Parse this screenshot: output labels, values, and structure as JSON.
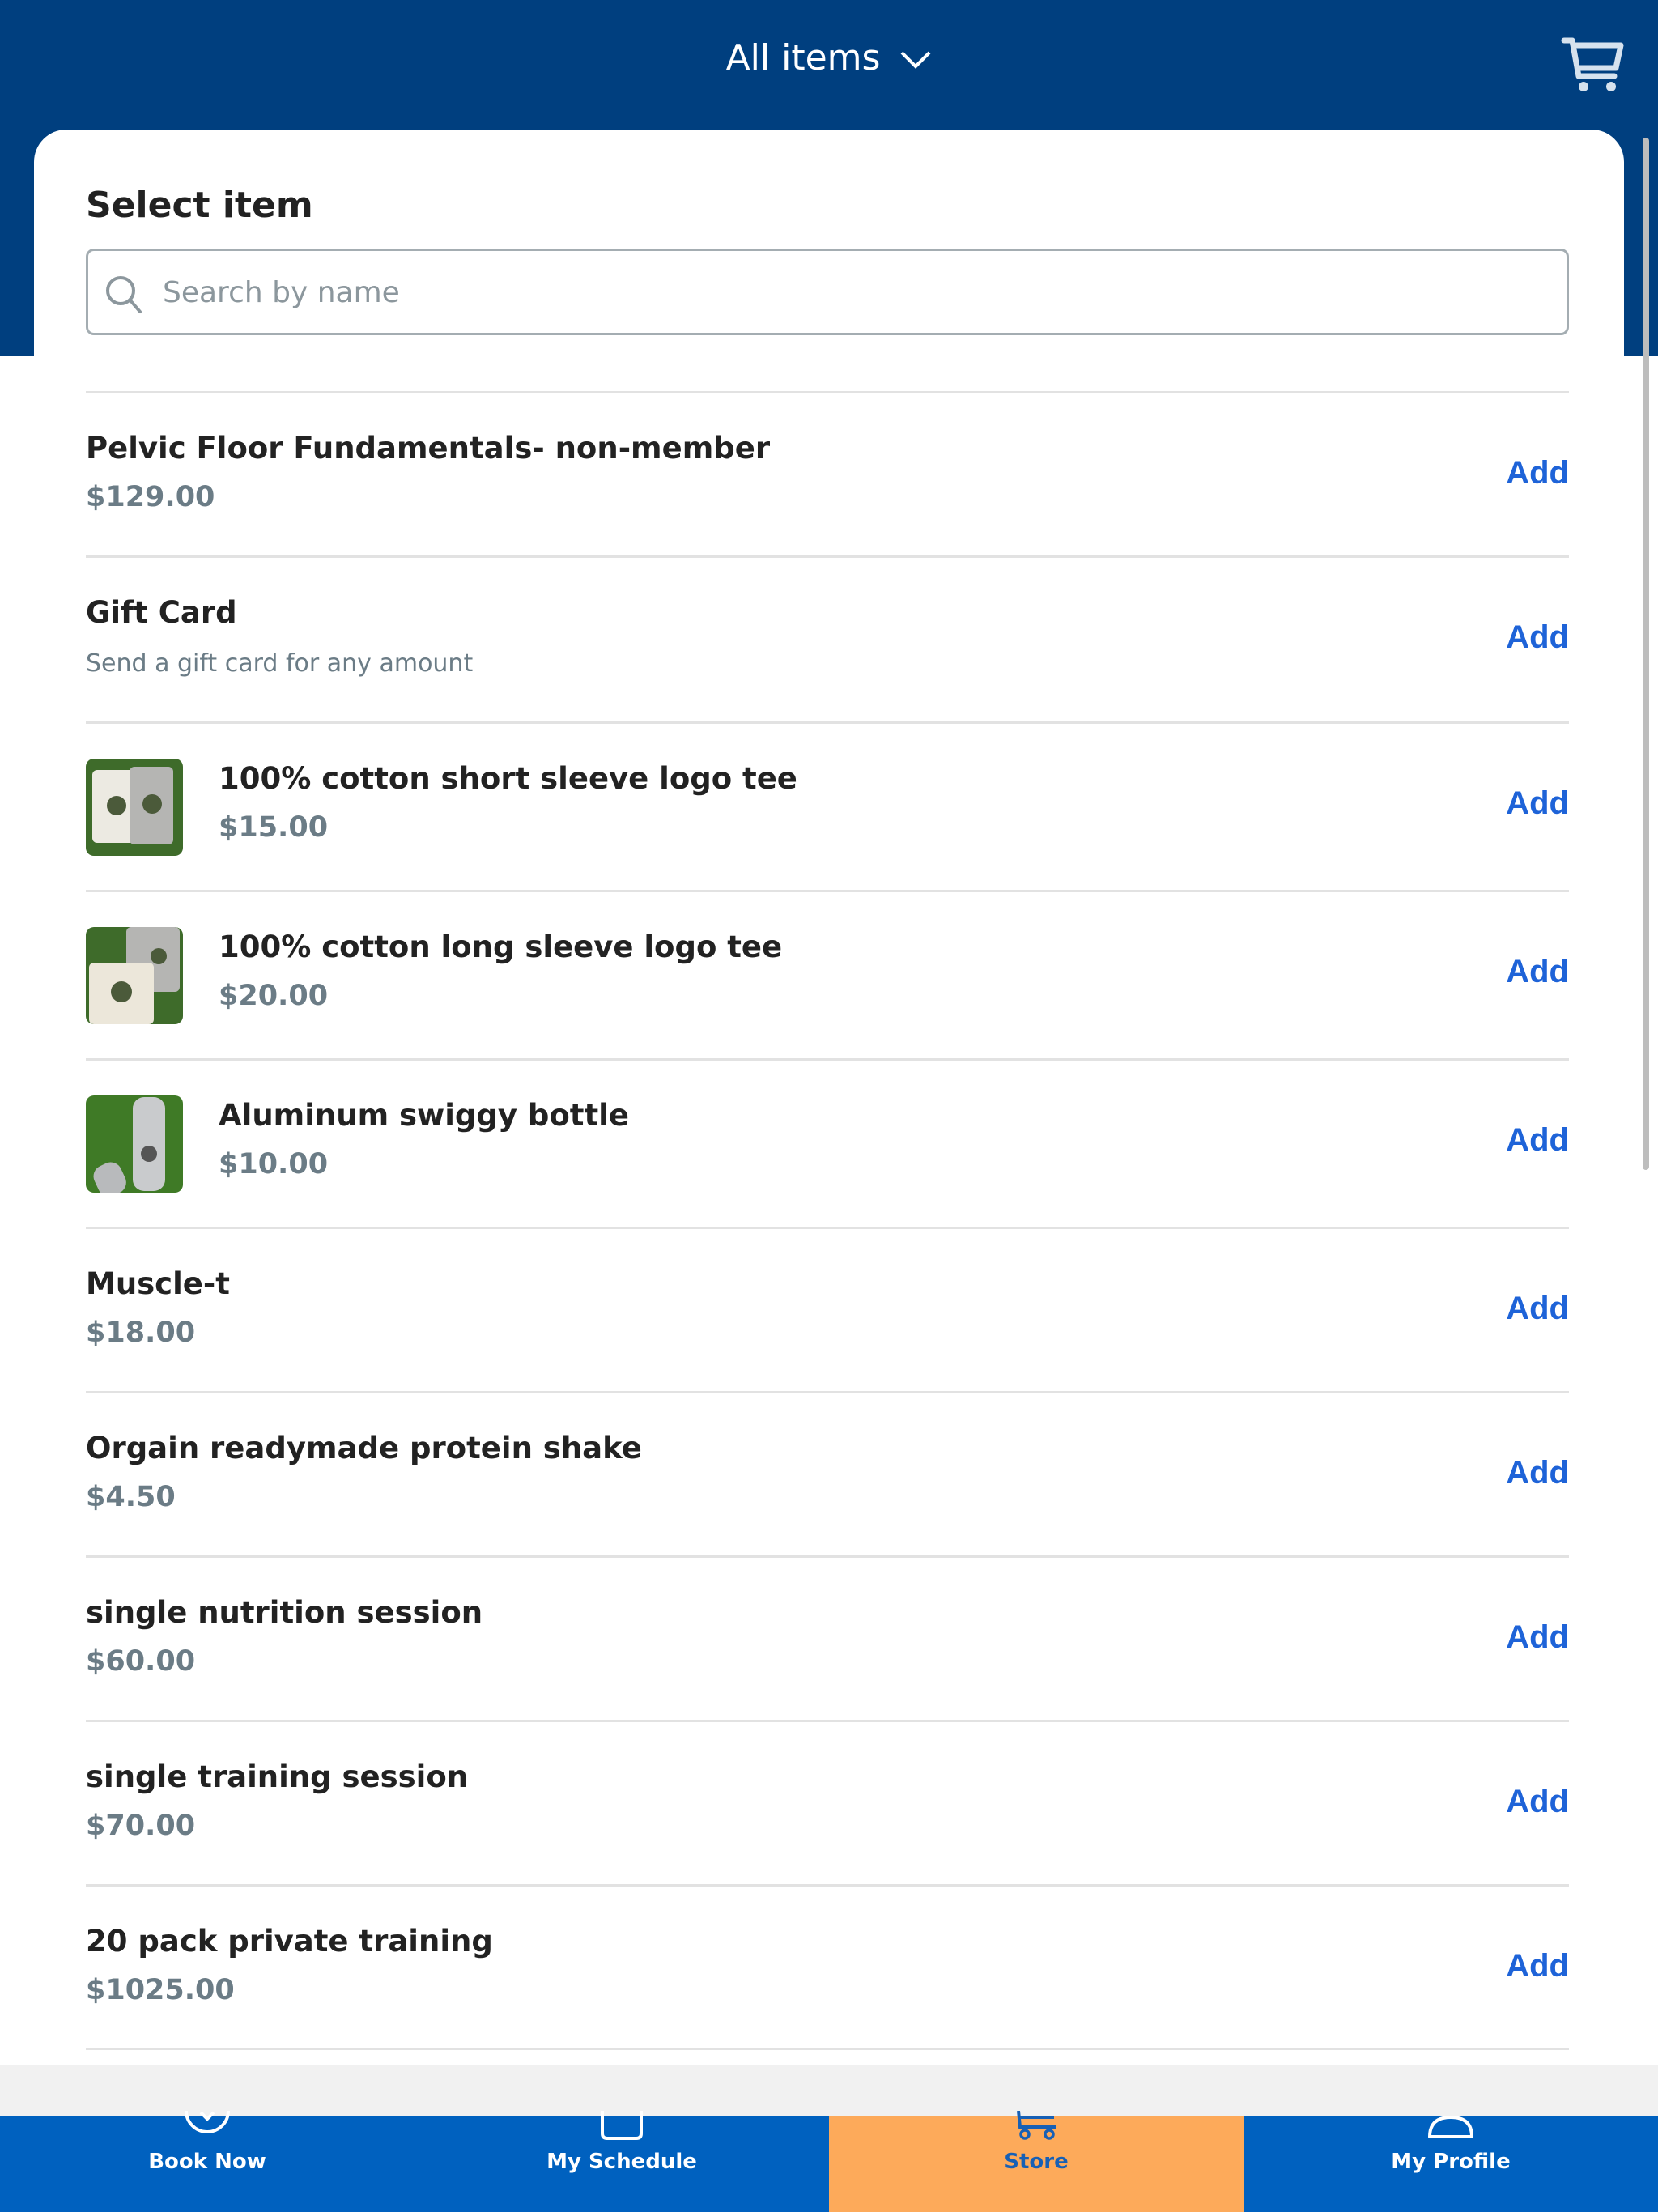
{
  "header": {
    "title": "All items",
    "title_icon": "chevron-down-icon",
    "cart_icon": "shopping-cart-icon",
    "bg_color": "#003F7F"
  },
  "panel": {
    "heading": "Select item",
    "search": {
      "placeholder": "Search by name",
      "value": "",
      "icon": "search-icon"
    }
  },
  "items": [
    {
      "name": "Pelvic Floor Fundamentals- non-member",
      "price": "$129.00",
      "has_image": false,
      "action": "Add"
    },
    {
      "name": "Gift Card",
      "description": "Send a gift card for any amount",
      "has_image": false,
      "action": "Add"
    },
    {
      "name": "100% cotton short sleeve logo tee",
      "price": "$15.00",
      "has_image": true,
      "image": "tshirts-on-grass",
      "action": "Add"
    },
    {
      "name": "100% cotton long sleeve logo tee",
      "price": "$20.00",
      "has_image": true,
      "image": "longsleeve-tees-on-grass",
      "action": "Add"
    },
    {
      "name": "Aluminum swiggy bottle",
      "price": "$10.00",
      "has_image": true,
      "image": "bottles-on-grass",
      "action": "Add"
    },
    {
      "name": "Muscle-t",
      "price": "$18.00",
      "has_image": false,
      "action": "Add"
    },
    {
      "name": "Orgain readymade protein shake",
      "price": "$4.50",
      "has_image": false,
      "action": "Add"
    },
    {
      "name": "single nutrition session",
      "price": "$60.00",
      "has_image": false,
      "action": "Add"
    },
    {
      "name": "single training session",
      "price": "$70.00",
      "has_image": false,
      "action": "Add"
    },
    {
      "name": "20 pack private training",
      "price": "$1025.00",
      "has_image": false,
      "action": "Add"
    }
  ],
  "bottom_nav": {
    "tabs": [
      {
        "label": "Book Now",
        "icon": "check-circle-icon",
        "active": false
      },
      {
        "label": "My Schedule",
        "icon": "calendar-icon",
        "active": false
      },
      {
        "label": "Store",
        "icon": "cart-icon",
        "active": true
      },
      {
        "label": "My Profile",
        "icon": "profile-icon",
        "active": false
      }
    ],
    "bg_color": "#0061BF",
    "active_color": "#FDAA5A"
  },
  "colors": {
    "accent": "#1E63D8",
    "price": "#6B7C86"
  }
}
